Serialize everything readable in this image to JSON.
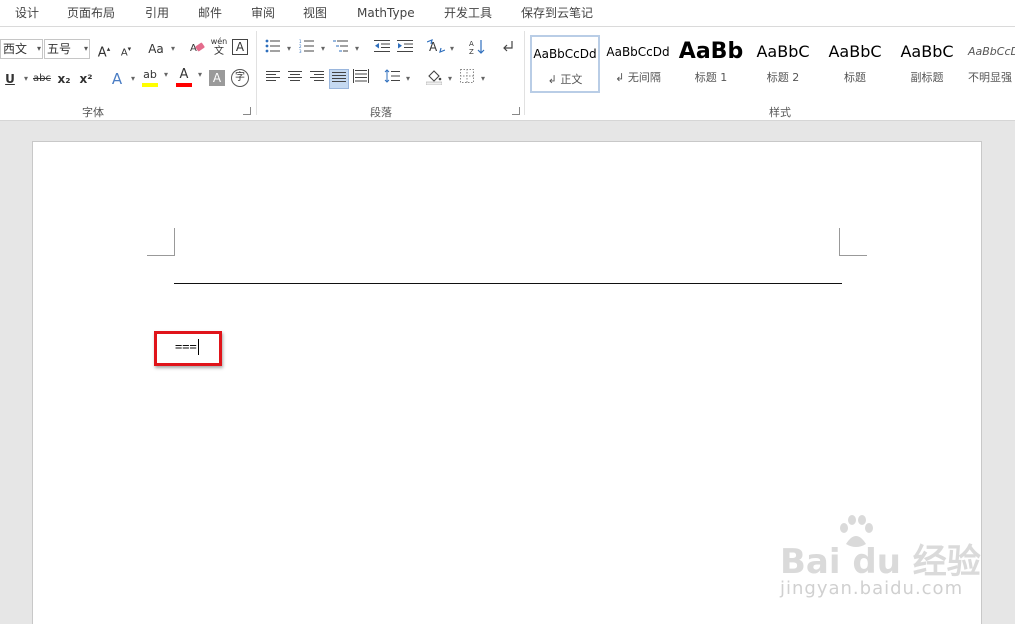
{
  "menu": {
    "items": [
      "设计",
      "页面布局",
      "引用",
      "邮件",
      "审阅",
      "视图",
      "MathType",
      "开发工具",
      "保存到云笔记"
    ]
  },
  "ribbon": {
    "font_group": {
      "label": "字体",
      "font_name": "西文",
      "font_size": "五号",
      "grow_font": "A",
      "shrink_font": "A",
      "change_case": "Aa",
      "phonetic_top": "wén",
      "phonetic_bottom": "文",
      "char_border": "A",
      "underline": "U",
      "strikethrough": "abc",
      "subscript": "x₂",
      "superscript": "x²",
      "text_effects": "A",
      "highlight": "ab",
      "font_color": "A",
      "char_shading": "A",
      "enclose_char": "字"
    },
    "paragraph_group": {
      "label": "段落"
    },
    "styles_group": {
      "label": "样式",
      "tiles": [
        {
          "sample": "AaBbCcDd",
          "name": "↲ 正文"
        },
        {
          "sample": "AaBbCcDd",
          "name": "↲ 无间隔"
        },
        {
          "sample": "AaBb",
          "name": "标题 1"
        },
        {
          "sample": "AaBbC",
          "name": "标题 2"
        },
        {
          "sample": "AaBbC",
          "name": "标题"
        },
        {
          "sample": "AaBbC",
          "name": "副标题"
        },
        {
          "sample": "AaBbCcD",
          "name": "不明显强"
        }
      ]
    }
  },
  "document": {
    "typed_text": "==="
  },
  "watermark": {
    "logo": "Bai du 经验",
    "url": "jingyan.baidu.com"
  },
  "colors": {
    "highlight_box": "#e0141a",
    "highlight_yellow": "#ffff00",
    "font_color_red": "#ff0000",
    "selected_style_border": "#b9cde6"
  }
}
